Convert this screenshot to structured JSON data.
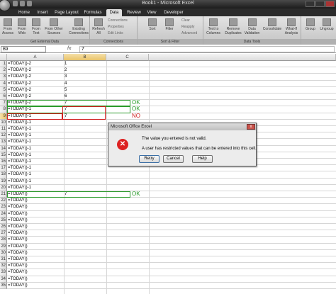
{
  "window": {
    "title": "Book1 - Microsoft Excel"
  },
  "tabs": [
    "Home",
    "Insert",
    "Page Layout",
    "Formulas",
    "Data",
    "Review",
    "View",
    "Developer"
  ],
  "active_tab": "Data",
  "ribbon": {
    "groups": [
      {
        "name": "Get External Data",
        "buttons": [
          "From Access",
          "From Web",
          "From Text",
          "From Other Sources",
          "Existing Connections"
        ]
      },
      {
        "name": "Connections",
        "buttons": [
          "Refresh All",
          "Connections",
          "Properties",
          "Edit Links"
        ]
      },
      {
        "name": "Sort & Filter",
        "buttons": [
          "Sort",
          "Filter",
          "Clear",
          "Reapply",
          "Advanced"
        ]
      },
      {
        "name": "Data Tools",
        "buttons": [
          "Text to Columns",
          "Remove Duplicates",
          "Data Validation",
          "Consolidate",
          "What-If Analysis"
        ]
      },
      {
        "name": "",
        "buttons": [
          "Group",
          "Ungroup"
        ]
      }
    ]
  },
  "formula_bar": {
    "name_box": "B9",
    "fx": "fx",
    "value": "7"
  },
  "grid": {
    "columns": [
      "A",
      "B",
      "C"
    ],
    "rows": [
      {
        "n": "1",
        "a": "=TODAY()-2",
        "b": "1"
      },
      {
        "n": "2",
        "a": "=TODAY()-2",
        "b": "2"
      },
      {
        "n": "3",
        "a": "=TODAY()-2",
        "b": "3"
      },
      {
        "n": "4",
        "a": "=TODAY()-2",
        "b": "4"
      },
      {
        "n": "5",
        "a": "=TODAY()-2",
        "b": "5"
      },
      {
        "n": "6",
        "a": "=TODAY()-2",
        "b": "6"
      },
      {
        "n": "7",
        "a": "=TODAY()-2",
        "b": "7"
      },
      {
        "n": "8",
        "a": "=TODAY()-1",
        "b": "7"
      },
      {
        "n": "9",
        "a": "=TODAY()-1",
        "b": "7"
      },
      {
        "n": "10",
        "a": "=TODAY()-1",
        "b": ""
      },
      {
        "n": "11",
        "a": "=TODAY()-1",
        "b": ""
      },
      {
        "n": "12",
        "a": "=TODAY()-1",
        "b": ""
      },
      {
        "n": "13",
        "a": "=TODAY()-1",
        "b": ""
      },
      {
        "n": "14",
        "a": "=TODAY()-1",
        "b": ""
      },
      {
        "n": "15",
        "a": "=TODAY()-1",
        "b": ""
      },
      {
        "n": "16",
        "a": "=TODAY()-1",
        "b": ""
      },
      {
        "n": "17",
        "a": "=TODAY()-1",
        "b": ""
      },
      {
        "n": "18",
        "a": "=TODAY()-1",
        "b": ""
      },
      {
        "n": "19",
        "a": "=TODAY()-1",
        "b": ""
      },
      {
        "n": "20",
        "a": "=TODAY()-1",
        "b": ""
      },
      {
        "n": "21",
        "a": "=TODAY()",
        "b": "7"
      },
      {
        "n": "22",
        "a": "=TODAY()",
        "b": ""
      },
      {
        "n": "23",
        "a": "=TODAY()",
        "b": ""
      },
      {
        "n": "24",
        "a": "=TODAY()",
        "b": ""
      },
      {
        "n": "25",
        "a": "=TODAY()",
        "b": ""
      },
      {
        "n": "26",
        "a": "=TODAY()",
        "b": ""
      },
      {
        "n": "27",
        "a": "=TODAY()",
        "b": ""
      },
      {
        "n": "28",
        "a": "=TODAY()",
        "b": ""
      },
      {
        "n": "29",
        "a": "=TODAY()",
        "b": ""
      },
      {
        "n": "30",
        "a": "=TODAY()",
        "b": ""
      },
      {
        "n": "31",
        "a": "=TODAY()",
        "b": ""
      },
      {
        "n": "32",
        "a": "=TODAY()",
        "b": ""
      },
      {
        "n": "33",
        "a": "=TODAY()",
        "b": ""
      },
      {
        "n": "34",
        "a": "=TODAY()",
        "b": ""
      },
      {
        "n": "35",
        "a": "=TODAY()",
        "b": ""
      }
    ]
  },
  "annotations": {
    "ok1": "OK",
    "ok2": "OK",
    "no": "NO",
    "ok3": "OK",
    "ok_color": "#2a9a2a",
    "no_color": "#d02020"
  },
  "dialog": {
    "title": "Microsoft Office Excel",
    "close": "x",
    "icon": "error-icon",
    "message1": "The value you entered is not valid.",
    "message2": "A user has restricted values that can be entered into this cell.",
    "retry": "Retry",
    "cancel": "Cancel",
    "help": "Help"
  }
}
